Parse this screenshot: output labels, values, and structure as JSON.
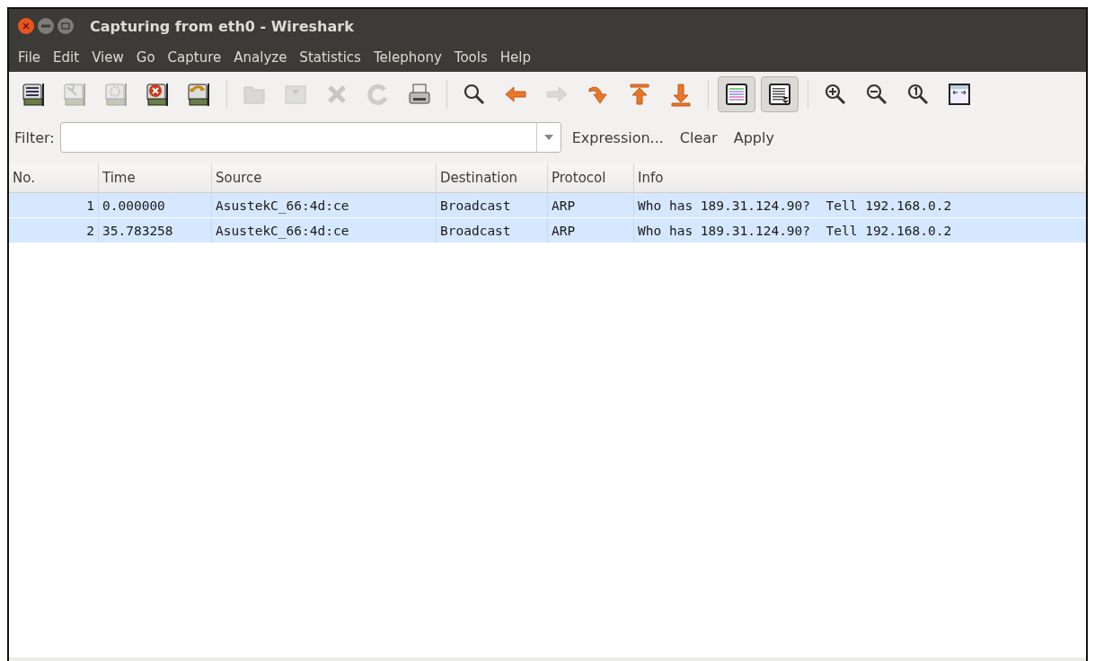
{
  "window": {
    "title": "Capturing from eth0 - Wireshark"
  },
  "menu": [
    "File",
    "Edit",
    "View",
    "Go",
    "Capture",
    "Analyze",
    "Statistics",
    "Telephony",
    "Tools",
    "Help"
  ],
  "toolbar": [
    {
      "kind": "interfaces",
      "disabled": false
    },
    {
      "kind": "options",
      "disabled": true
    },
    {
      "kind": "start",
      "disabled": true
    },
    {
      "kind": "stop",
      "disabled": false
    },
    {
      "kind": "restart",
      "disabled": false
    },
    {
      "kind": "separator"
    },
    {
      "kind": "open",
      "disabled": true
    },
    {
      "kind": "save",
      "disabled": true
    },
    {
      "kind": "close",
      "disabled": true
    },
    {
      "kind": "reload",
      "disabled": true
    },
    {
      "kind": "print",
      "disabled": false
    },
    {
      "kind": "separator"
    },
    {
      "kind": "find",
      "disabled": false
    },
    {
      "kind": "back",
      "disabled": false
    },
    {
      "kind": "forward",
      "disabled": true
    },
    {
      "kind": "goto",
      "disabled": false
    },
    {
      "kind": "first",
      "disabled": false
    },
    {
      "kind": "last",
      "disabled": false
    },
    {
      "kind": "separator"
    },
    {
      "kind": "colorize",
      "disabled": false,
      "selected": true
    },
    {
      "kind": "autoscroll",
      "disabled": false,
      "selected": true
    },
    {
      "kind": "separator"
    },
    {
      "kind": "zoom-in",
      "disabled": false
    },
    {
      "kind": "zoom-out",
      "disabled": false
    },
    {
      "kind": "zoom-normal",
      "disabled": false
    },
    {
      "kind": "resize",
      "disabled": false
    }
  ],
  "filter": {
    "label": "Filter:",
    "buttons": [
      "Expression...",
      "Clear",
      "Apply"
    ]
  },
  "table": {
    "columns": [
      "No.",
      "Time",
      "Source",
      "Destination",
      "Protocol",
      "Info"
    ],
    "rows": [
      {
        "color": "#d6e8ff",
        "cells": [
          "1",
          "0.000000",
          "AsustekC_66:4d:ce",
          "Broadcast",
          "ARP",
          "Who has 189.31.124.90?  Tell 192.168.0.2"
        ]
      },
      {
        "color": "#d6e8ff",
        "cells": [
          "2",
          "35.783258",
          "AsustekC_66:4d:ce",
          "Broadcast",
          "ARP",
          "Who has 189.31.124.90?  Tell 192.168.0.2"
        ]
      }
    ]
  }
}
